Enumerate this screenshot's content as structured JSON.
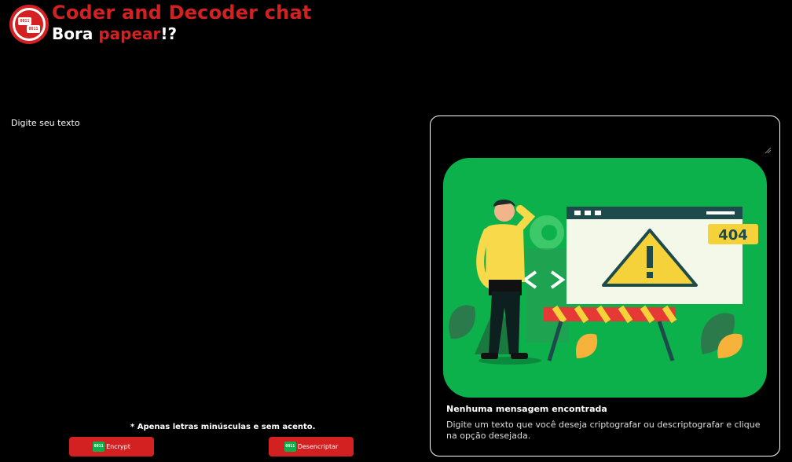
{
  "header": {
    "logo_bits_top": "0011",
    "logo_bits_bottom": "0011",
    "title": "Coder and Decoder chat",
    "subtitle_start": "Bora ",
    "subtitle_accent": "papear",
    "subtitle_end": "!?"
  },
  "input": {
    "placeholder": "Digite seu texto",
    "value": ""
  },
  "hint": "* Apenas letras minúsculas e sem acento.",
  "buttons": {
    "encrypt_label": "Encrypt",
    "decrypt_label": "Desencriptar",
    "icon_text": "0011"
  },
  "output": {
    "illustration_badge": "404",
    "no_message_title": "Nenhuma mensagem encontrada",
    "instruction": "Digite um texto que você deseja criptografar ou descriptografar e clique na opção desejada."
  },
  "colors": {
    "accent": "#d32020",
    "background": "#000000",
    "illustration_bg": "#0db14b"
  }
}
